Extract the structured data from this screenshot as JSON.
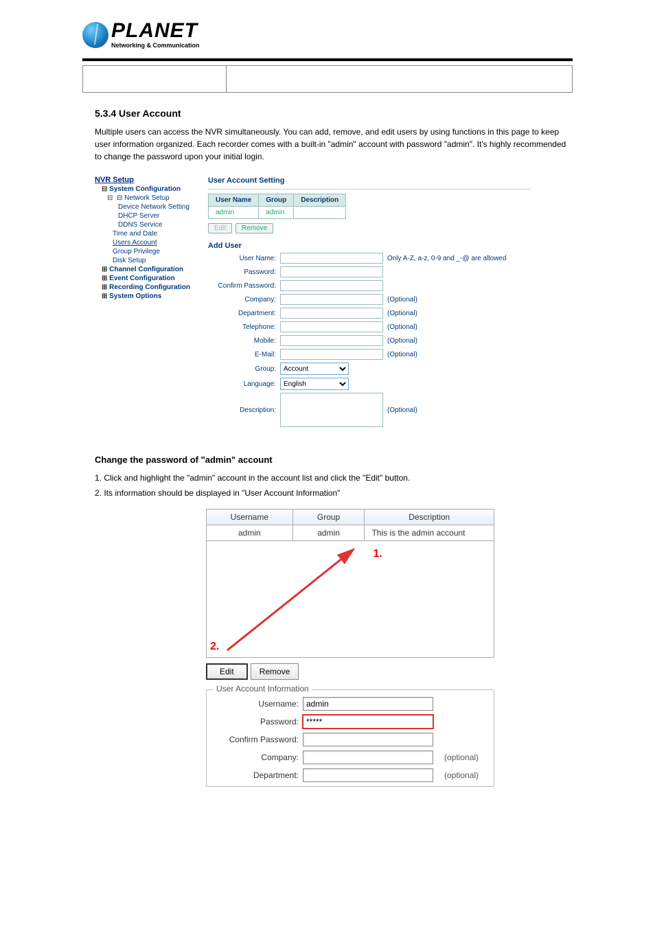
{
  "logo": {
    "main": "PLANET",
    "sub": "Networking & Communication"
  },
  "section5_3_4": {
    "title": "5.3.4 User Account",
    "para1": "Multiple users can access the NVR simultaneously. You can add, remove, and edit users by using functions in this page to keep user information organized. Each recorder comes with a built-in \"admin\" account with password \"admin\". It's highly recommended to change the password upon your initial login."
  },
  "shot1": {
    "nav": {
      "top": "NVR Setup",
      "system_config": "System Configuration",
      "network_setup": "Network Setup",
      "dev_net": "Device Network Setting",
      "dhcp": "DHCP Server",
      "ddns": "DDNS Service",
      "time": "Time and Date",
      "users_account": "Users Account",
      "group_priv": "Group Privilege",
      "disk_setup": "Disk Setup",
      "channel_config": "Channel Configuration",
      "event_config": "Event Configuration",
      "recording_config": "Recording Configuration",
      "system_options": "System Options"
    },
    "panel": {
      "title": "User Account Setting",
      "th_user": "User Name",
      "th_group": "Group",
      "th_desc": "Description",
      "row_user": "admin",
      "row_group": "admin",
      "edit": "Edit",
      "remove": "Remove",
      "adduser": "Add User",
      "f_user": "User Name:",
      "f_pw": "Password:",
      "f_cpw": "Confirm Password:",
      "f_company": "Company:",
      "f_dept": "Department:",
      "f_tel": "Telephone:",
      "f_mobile": "Mobile:",
      "f_email": "E-Mail:",
      "f_group": "Group:",
      "f_lang": "Language:",
      "f_desc": "Description:",
      "hint_allowed": "Only A-Z, a-z, 0-9 and _-@ are allowed",
      "hint_opt": "(Optional)",
      "sel_group": "Account",
      "sel_lang": "English"
    }
  },
  "change_pw": {
    "heading": "Change the password of \"admin\" account",
    "step1": "Click and highlight the \"admin\" account in the account list and click the \"Edit\" button.",
    "step2": "Its information should be displayed in \"User Account Information\""
  },
  "shot2": {
    "th_user": "Username",
    "th_group": "Group",
    "th_desc": "Description",
    "row_user": "admin",
    "row_group": "admin",
    "row_desc": "This is the admin account",
    "num1": "1.",
    "num2": "2.",
    "edit": "Edit",
    "remove": "Remove",
    "legend": "User Account Information",
    "f_user": "Username:",
    "f_pw": "Password:",
    "f_cpw": "Confirm Password:",
    "f_company": "Company:",
    "f_dept": "Department:",
    "v_user": "admin",
    "v_pw": "*****",
    "opt": "(optional)"
  }
}
